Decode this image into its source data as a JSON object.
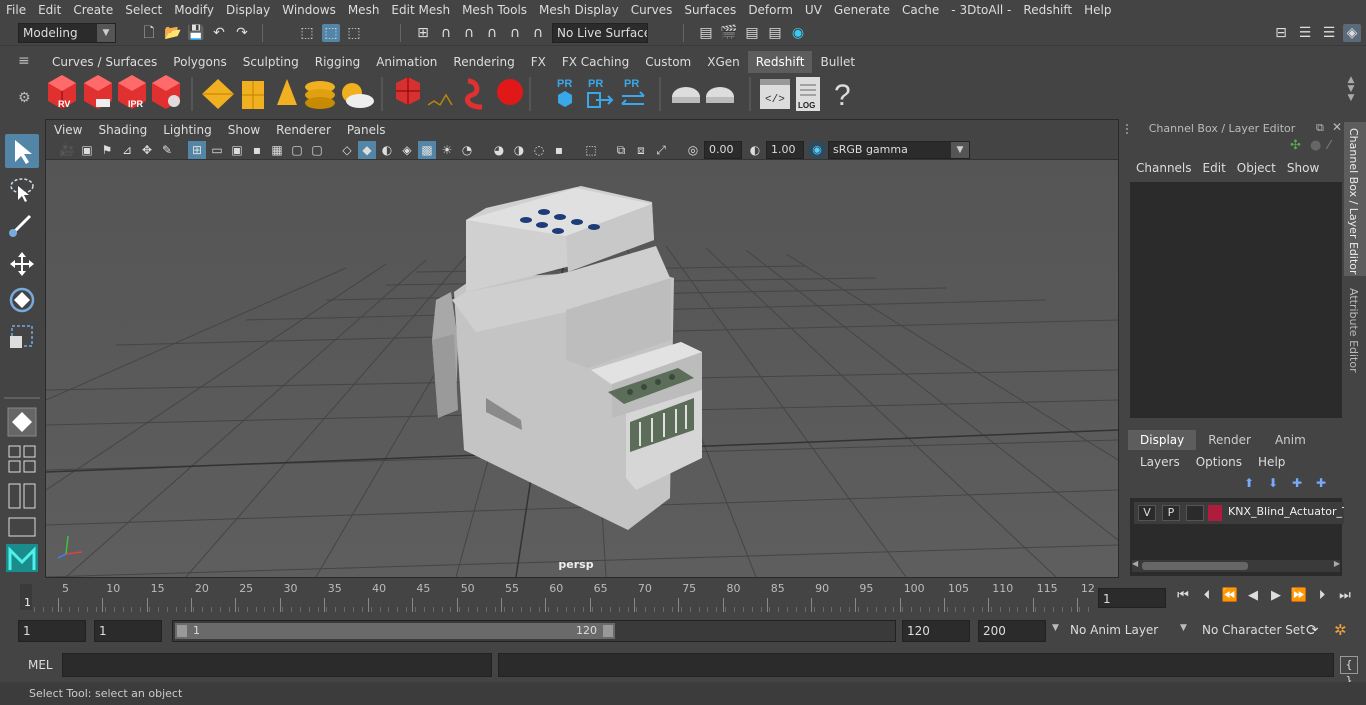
{
  "menubar": [
    "File",
    "Edit",
    "Create",
    "Select",
    "Modify",
    "Display",
    "Windows",
    "Mesh",
    "Edit Mesh",
    "Mesh Tools",
    "Mesh Display",
    "Curves",
    "Surfaces",
    "Deform",
    "UV",
    "Generate",
    "Cache",
    "- 3DtoAll -",
    "Redshift",
    "Help"
  ],
  "statusline": {
    "mode": "Modeling",
    "live_surface": "No Live Surface"
  },
  "shelf_tabs": [
    "Curves / Surfaces",
    "Polygons",
    "Sculpting",
    "Rigging",
    "Animation",
    "Rendering",
    "FX",
    "FX Caching",
    "Custom",
    "XGen",
    "Redshift",
    "Bullet"
  ],
  "shelf_active": "Redshift",
  "shelf_labels": {
    "rv": "RV",
    "ipr": "IPR",
    "pr1": "PR",
    "pr2": "PR",
    "pr3": "PR",
    "log": "LOG"
  },
  "viewport": {
    "menus": [
      "View",
      "Shading",
      "Lighting",
      "Show",
      "Renderer",
      "Panels"
    ],
    "exposure": "0.00",
    "gamma": "1.00",
    "color_space": "sRGB gamma",
    "camera_label": "persp"
  },
  "channel_box": {
    "title": "Channel Box / Layer Editor",
    "menus": [
      "Channels",
      "Edit",
      "Object",
      "Show"
    ]
  },
  "layer_editor": {
    "tabs": [
      "Display",
      "Render",
      "Anim"
    ],
    "active_tab": "Display",
    "menus": [
      "Layers",
      "Options",
      "Help"
    ],
    "layer": {
      "v": "V",
      "p": "P",
      "name": "KNX_Blind_Actuator_Tw",
      "color": "#b01c3c"
    }
  },
  "side_tabs": [
    "Channel Box / Layer Editor",
    "Attribute Editor"
  ],
  "timeline": {
    "labels": [
      "5",
      "10",
      "15",
      "20",
      "25",
      "30",
      "35",
      "40",
      "45",
      "50",
      "55",
      "60",
      "65",
      "70",
      "75",
      "80",
      "85",
      "90",
      "95",
      "100",
      "105",
      "110",
      "115",
      "12"
    ],
    "start_marker": "1",
    "current_frame": "1"
  },
  "range": {
    "start": "1",
    "playback_start": "1",
    "slider_start": "1",
    "slider_end": "120",
    "playback_end": "120",
    "end": "200",
    "anim_layer": "No Anim Layer",
    "character_set": "No Character Set"
  },
  "mel_label": "MEL",
  "help_line": "Select Tool: select an object"
}
